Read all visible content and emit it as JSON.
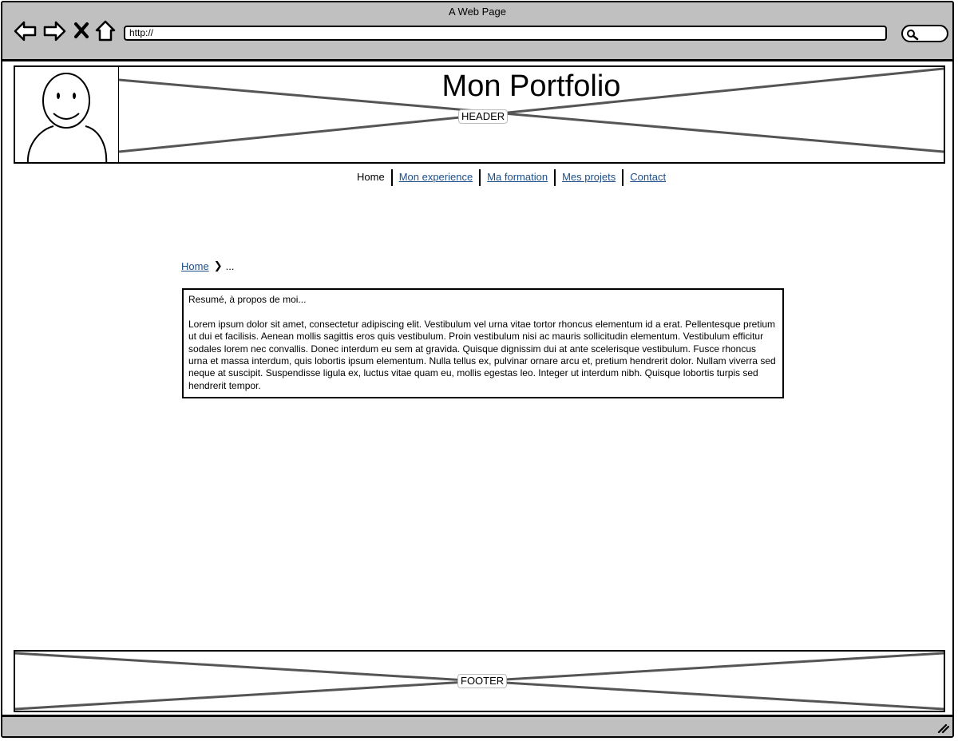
{
  "window": {
    "title": "A Web Page"
  },
  "browser": {
    "url": "http://",
    "icons": [
      "back-arrow-icon",
      "forward-arrow-icon",
      "stop-icon",
      "home-icon",
      "search-icon"
    ]
  },
  "header": {
    "title": "Mon Portfolio",
    "placeholder_label": "HEADER",
    "avatar_icon": "user-avatar-icon"
  },
  "nav": {
    "items": [
      {
        "label": "Home",
        "current": true
      },
      {
        "label": "Mon experience",
        "current": false
      },
      {
        "label": "Ma formation",
        "current": false
      },
      {
        "label": "Mes projets",
        "current": false
      },
      {
        "label": "Contact",
        "current": false
      }
    ]
  },
  "breadcrumb": {
    "home": "Home",
    "separator_icon": "chevron-right-icon",
    "current": "..."
  },
  "content": {
    "heading": "Resumé, à propos de moi...",
    "body": "Lorem ipsum dolor sit amet, consectetur adipiscing elit. Vestibulum vel urna vitae tortor rhoncus elementum id a erat. Pellentesque pretium ut dui et facilisis. Aenean mollis sagittis eros quis vestibulum. Proin vestibulum nisi ac mauris sollicitudin elementum. Vestibulum efficitur sodales lorem nec convallis. Donec interdum eu sem at gravida. Quisque dignissim dui at ante scelerisque vestibulum. Fusce rhoncus urna et massa interdum, quis lobortis ipsum elementum. Nulla tellus ex, pulvinar ornare arcu et, pretium hendrerit dolor. Nullam viverra sed neque at suscipit. Suspendisse ligula ex, luctus vitae quam eu, mollis egestas leo. Integer ut interdum nibh. Quisque lobortis turpis sed hendrerit tempor."
  },
  "footer": {
    "placeholder_label": "FOOTER"
  },
  "colors": {
    "chrome": "#c0c0c0",
    "link": "#1d4e89",
    "placeholder_line": "#555555"
  }
}
